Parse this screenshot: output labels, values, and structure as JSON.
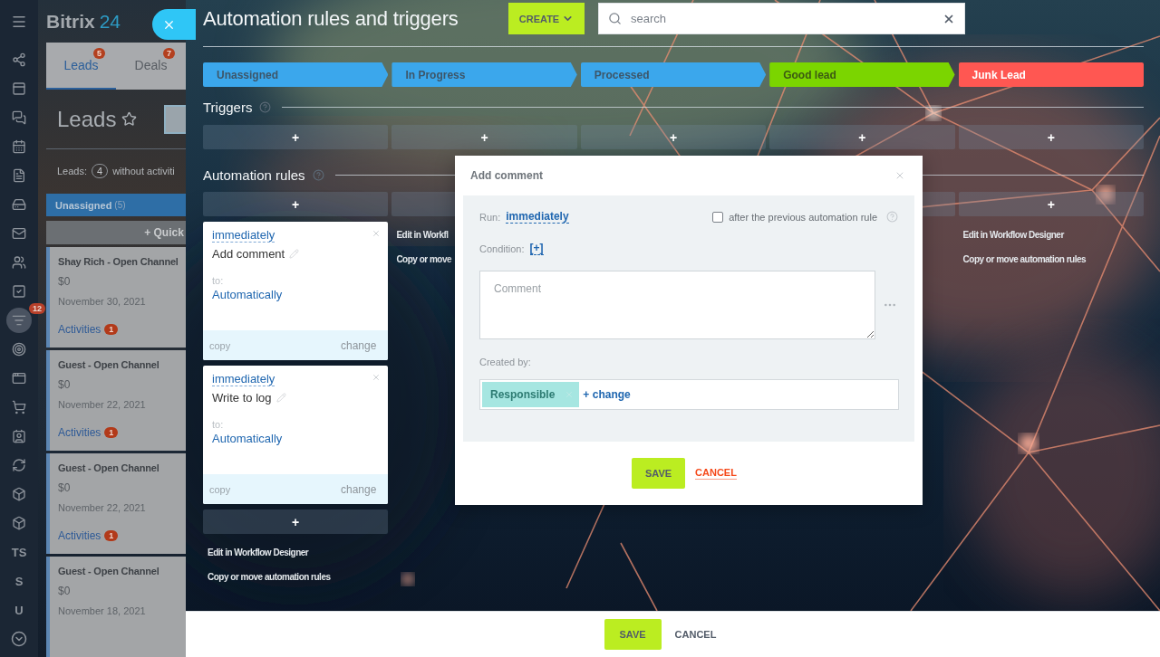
{
  "sidebar": {
    "items": [
      {
        "kind": "icon",
        "selected": false
      },
      {
        "kind": "icon",
        "selected": false
      },
      {
        "kind": "icon",
        "selected": false
      },
      {
        "kind": "icon",
        "selected": false
      },
      {
        "kind": "icon",
        "selected": false
      },
      {
        "kind": "icon",
        "selected": false
      },
      {
        "kind": "icon",
        "selected": false
      },
      {
        "kind": "icon",
        "selected": false
      },
      {
        "kind": "icon",
        "selected": false
      },
      {
        "kind": "icon",
        "selected": true,
        "badge": "12"
      },
      {
        "kind": "icon",
        "selected": false
      },
      {
        "kind": "icon",
        "selected": false
      },
      {
        "kind": "icon",
        "selected": false
      },
      {
        "kind": "icon",
        "selected": false
      },
      {
        "kind": "icon",
        "selected": false
      },
      {
        "kind": "icon",
        "selected": false
      },
      {
        "kind": "icon",
        "selected": false
      },
      {
        "kind": "text",
        "label": "TS",
        "selected": false
      },
      {
        "kind": "text",
        "label": "S",
        "selected": false
      },
      {
        "kind": "text",
        "label": "U",
        "selected": false
      }
    ]
  },
  "crm": {
    "logo": {
      "name": "Bitrix",
      "number": "24"
    },
    "tabs": [
      {
        "label": "Leads",
        "badge": "5",
        "selected": true
      },
      {
        "label": "Deals",
        "badge": "7",
        "selected": false
      }
    ],
    "title": "Leads",
    "counter": {
      "label": "Leads:",
      "count": "4",
      "text": "without activiti"
    },
    "column": {
      "title": "Unassigned",
      "count": "(5)"
    },
    "quick_add": "+ Quick",
    "cards": [
      {
        "title": "Shay Rich - Open Channel",
        "amount": "$0",
        "date": "November 30, 2021",
        "activities": "Activities",
        "activity_count": "1"
      },
      {
        "title": "Guest - Open Channel",
        "amount": "$0",
        "date": "November 22, 2021",
        "activities": "Activities",
        "activity_count": "1"
      },
      {
        "title": "Guest - Open Channel",
        "amount": "$0",
        "date": "November 22, 2021",
        "activities": "Activities",
        "activity_count": "1"
      },
      {
        "title": "Guest - Open Channel",
        "amount": "$0",
        "date": "November 18, 2021"
      }
    ]
  },
  "panel": {
    "title": "Automation rules and triggers",
    "create_button": "CREATE",
    "search": {
      "placeholder": "search"
    },
    "stages": [
      {
        "label": "Unassigned",
        "color": "#3ba7ec",
        "kind": "process"
      },
      {
        "label": "In Progress",
        "color": "#3ba7ec",
        "kind": "process"
      },
      {
        "label": "Processed",
        "color": "#3ba7ec",
        "kind": "process"
      },
      {
        "label": "Good lead",
        "color": "#7bd500",
        "kind": "success"
      },
      {
        "label": "Junk Lead",
        "color": "#ff5752",
        "kind": "failure"
      }
    ],
    "triggers": {
      "heading": "Triggers",
      "slots": [
        "+",
        "+",
        "+",
        "+",
        "+"
      ]
    },
    "automation": {
      "heading": "Automation rules",
      "columns": [
        {
          "add": "+",
          "rules": [
            {
              "timing": "immediately",
              "name": "Add comment",
              "to_label": "to:",
              "to": "Automatically",
              "copy": "copy",
              "change": "change"
            },
            {
              "timing": "immediately",
              "name": "Write to log",
              "to_label": "to:",
              "to": "Automatically",
              "copy": "copy",
              "change": "change"
            }
          ],
          "bottom_add": "+",
          "links": [
            "Edit in Workflow Designer",
            "Copy or move automation rules"
          ]
        },
        {
          "kind": "blank",
          "links": [
            "Edit in Workfl",
            "Copy or move"
          ]
        },
        {},
        {
          "kind": "blank"
        },
        {
          "add": "+",
          "links": [
            "Edit in Workflow Designer",
            "Copy or move automation rules"
          ]
        }
      ]
    }
  },
  "dialog": {
    "title": "Add comment",
    "run_label": "Run:",
    "run_value": "immediately",
    "after_previous": {
      "label": "after the previous automation rule",
      "checked": false
    },
    "condition_label": "Condition:",
    "condition_value": "[+]",
    "comment": {
      "placeholder": "Comment"
    },
    "created_by_label": "Created by:",
    "created_by": {
      "tag": "Responsible",
      "change": "+ change"
    },
    "save": "SAVE",
    "cancel": "CANCEL"
  },
  "footer": {
    "save": "SAVE",
    "cancel": "CANCEL"
  }
}
